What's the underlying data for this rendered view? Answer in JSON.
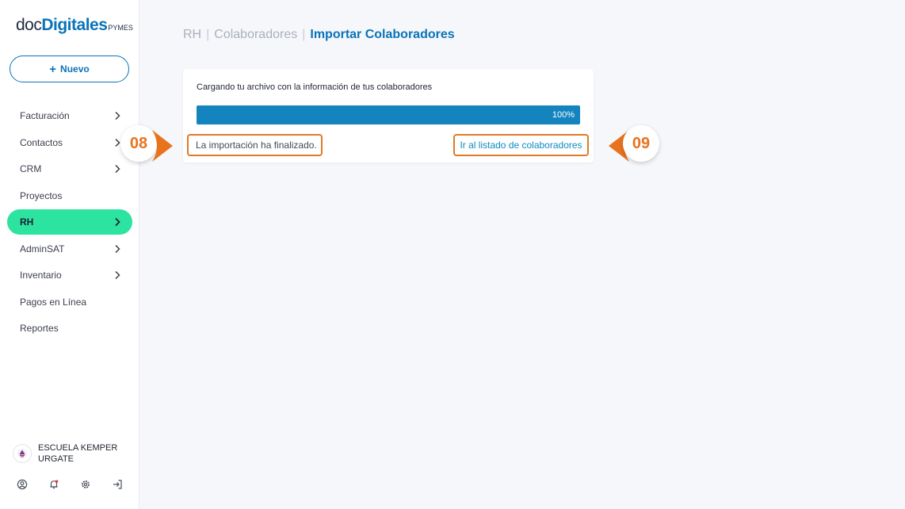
{
  "logo": {
    "doc": "doc",
    "digitales": "Digitales",
    "pymes": "PYMES"
  },
  "new_button": {
    "plus": "+",
    "label": "Nuevo"
  },
  "nav": [
    {
      "label": "Facturación",
      "chevron": true,
      "active": false
    },
    {
      "label": "Contactos",
      "chevron": true,
      "active": false
    },
    {
      "label": "CRM",
      "chevron": true,
      "active": false
    },
    {
      "label": "Proyectos",
      "chevron": false,
      "active": false
    },
    {
      "label": "RH",
      "chevron": true,
      "active": true
    },
    {
      "label": "AdminSAT",
      "chevron": true,
      "active": false
    },
    {
      "label": "Inventario",
      "chevron": true,
      "active": false
    },
    {
      "label": "Pagos en Línea",
      "chevron": false,
      "active": false
    },
    {
      "label": "Reportes",
      "chevron": false,
      "active": false
    }
  ],
  "account": {
    "name": "ESCUELA KEMPER URGATE"
  },
  "bottom_icons": [
    "user-circle-icon",
    "bell-icon",
    "gear-icon",
    "logout-icon"
  ],
  "breadcrumb": {
    "items": [
      "RH",
      "Colaboradores"
    ],
    "separator": "|",
    "current": "Importar Colaboradores"
  },
  "import_card": {
    "title": "Cargando tu archivo con la información de tus colaboradores",
    "progress": 100,
    "progress_label": "100%",
    "status": "La importación ha finalizado.",
    "link": "Ir al listado de colaboradores"
  },
  "callouts": {
    "left": "08",
    "right": "09"
  },
  "colors": {
    "brand_blue": "#0b73b8",
    "active_green": "#2de3a0",
    "progress_blue": "#1484be",
    "callout_orange": "#e07a29"
  }
}
